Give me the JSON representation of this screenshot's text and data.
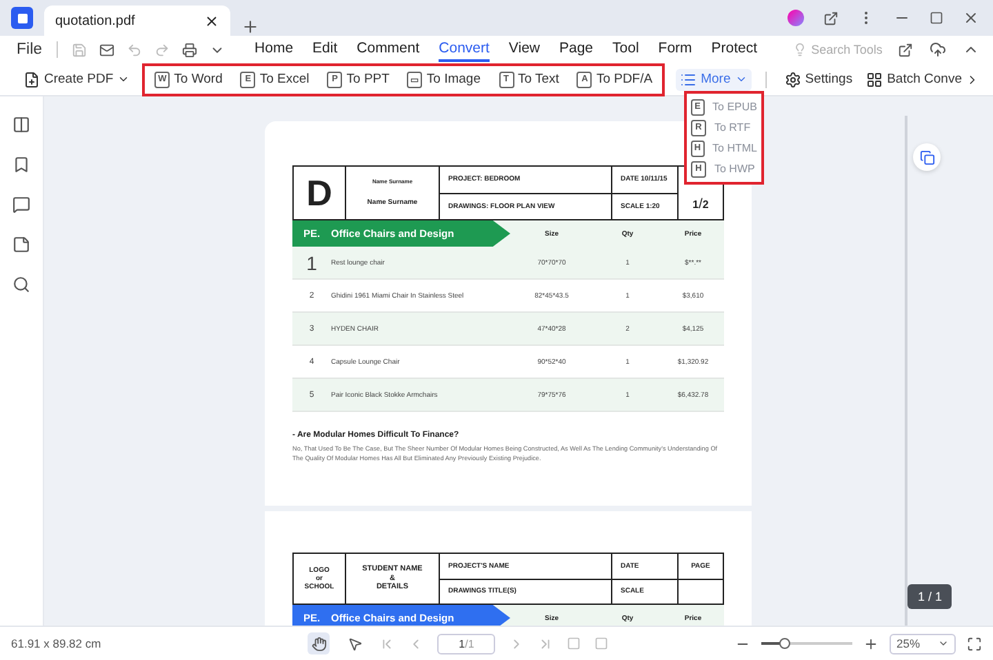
{
  "window": {
    "tabs": [
      {
        "title": "quotation.pdf",
        "selected": true
      }
    ]
  },
  "menu": {
    "file": "File",
    "tabs": [
      {
        "label": "Home",
        "selected": false
      },
      {
        "label": "Edit",
        "selected": false
      },
      {
        "label": "Comment",
        "selected": false
      },
      {
        "label": "Convert",
        "selected": true
      },
      {
        "label": "View",
        "selected": false
      },
      {
        "label": "Page",
        "selected": false
      },
      {
        "label": "Tool",
        "selected": false
      },
      {
        "label": "Form",
        "selected": false
      },
      {
        "label": "Protect",
        "selected": false
      }
    ],
    "search": {
      "placeholder": "Search Tools"
    }
  },
  "toolbar": {
    "create": "Create PDF",
    "convert": [
      {
        "letter": "W",
        "label": "To Word"
      },
      {
        "letter": "E",
        "label": "To Excel"
      },
      {
        "letter": "P",
        "label": "To PPT"
      },
      {
        "letter": "▭",
        "label": "To Image"
      },
      {
        "letter": "T",
        "label": "To Text"
      },
      {
        "letter": "A",
        "label": "To PDF/A"
      }
    ],
    "more": "More",
    "settings": "Settings",
    "batch": "Batch Conve"
  },
  "more_menu": [
    {
      "letter": "E",
      "label": "To EPUB"
    },
    {
      "letter": "R",
      "label": "To RTF"
    },
    {
      "letter": "H",
      "label": "To HTML"
    },
    {
      "letter": "H",
      "label": "To HWP"
    }
  ],
  "document": {
    "pages": [
      {
        "title_block": {
          "logo": [
            "D"
          ],
          "name": [
            "Name Surname",
            "Name Surname"
          ],
          "project": "PROJECT: BEDROOM",
          "drawings": "DRAWINGS: FLOOR PLAN VIEW",
          "date": "DATE 10/11/15",
          "scale": "SCALE 1:20",
          "page": [
            "1",
            "/",
            "2"
          ]
        },
        "table": {
          "header": {
            "code": "PE.",
            "title": "Office Chairs and Design",
            "color": "#1e9a52",
            "columns": [
              "Size",
              "Qty",
              "Price"
            ]
          },
          "rows": [
            {
              "no": "1",
              "item": "Rest lounge chair",
              "size": "70*70*70",
              "qty": "1",
              "price": "$**.**"
            },
            {
              "no": "2",
              "item": "Ghidini 1961 Miami Chair In Stainless Steel",
              "size": "82*45*43.5",
              "qty": "1",
              "price": "$3,610"
            },
            {
              "no": "3",
              "item": "HYDEN CHAIR",
              "size": "47*40*28",
              "qty": "2",
              "price": "$4,125"
            },
            {
              "no": "4",
              "item": "Capsule Lounge Chair",
              "size": "90*52*40",
              "qty": "1",
              "price": "$1,320.92"
            },
            {
              "no": "5",
              "item": "Pair Iconic Black Stokke Armchairs",
              "size": "79*75*76",
              "qty": "1",
              "price": "$6,432.78"
            }
          ]
        },
        "heading": "- Are Modular Homes Difficult To Finance?",
        "paragraph": "No, That Used To Be The Case, But The Sheer Number Of Modular Homes Being Constructed, As Well As The Lending Community's Understanding Of The Quality Of Modular Homes Has All But Eliminated Any Previously Existing Prejudice."
      },
      {
        "title_block": {
          "logo": [
            "LOGO",
            "or",
            "SCHOOL"
          ],
          "name": [
            "STUDENT NAME",
            "&",
            "DETAILS"
          ],
          "project": "PROJECT'S NAME",
          "drawings": "DRAWINGS TITLE(S)",
          "date": "DATE",
          "scale": "SCALE",
          "page": [
            "PAGE"
          ]
        },
        "table": {
          "header": {
            "code": "PE.",
            "title": "Office Chairs and Design",
            "color": "#2f6ff0",
            "columns": [
              "Size",
              "Qty",
              "Price"
            ]
          }
        }
      }
    ],
    "page_badge": "1 / 1"
  },
  "status_bar": {
    "size": "61.91 x 89.82 cm",
    "tools": [
      {
        "kind": "hand",
        "selected": true
      },
      {
        "kind": "select",
        "selected": false
      }
    ],
    "page": "1",
    "page_total": "/1",
    "zoom": {
      "level": 0.25,
      "value": "25%"
    }
  }
}
